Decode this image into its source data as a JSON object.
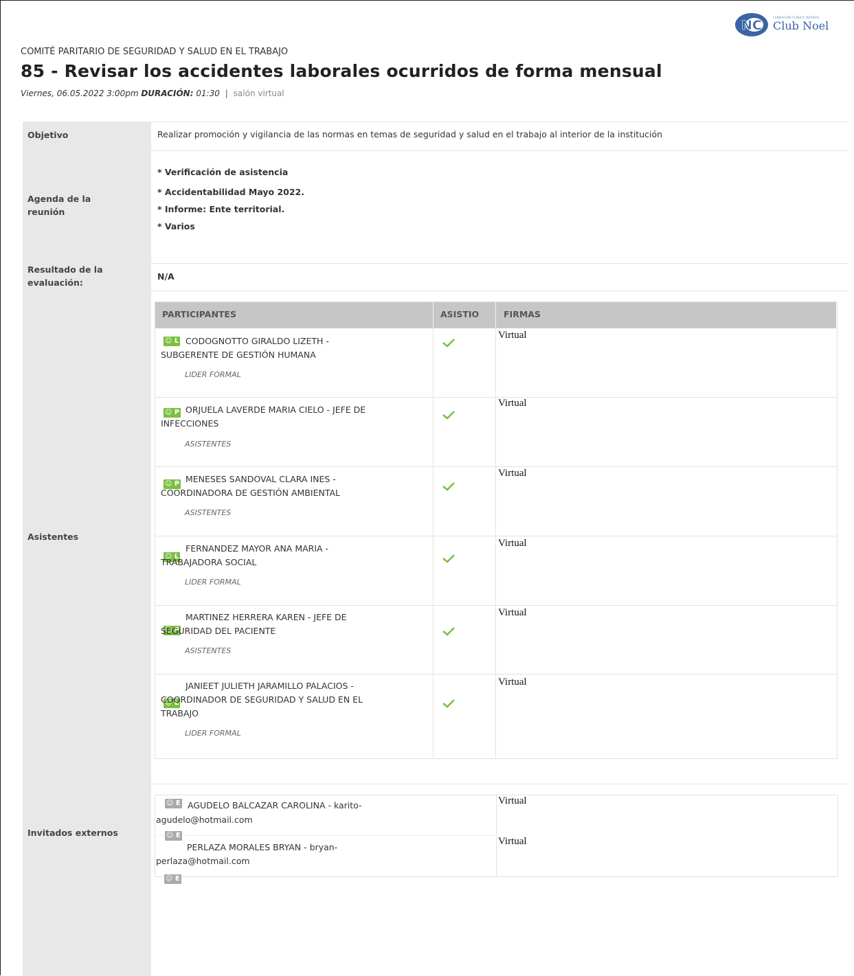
{
  "logo": {
    "initials": "NC",
    "tagline": "FUNDACIÓN CLÍNICA INFANTIL",
    "brand": "Club Noel"
  },
  "header": {
    "org": "COMITÉ PARITARIO DE SEGURIDAD Y SALUD EN EL TRABAJO",
    "title": "85 - Revisar los accidentes laborales ocurridos de forma mensual",
    "date": "Viernes, 06.05.2022 3:00pm",
    "duration_label": "DURACIÓN:",
    "duration": "01:30",
    "separator": "|",
    "room": "salón virtual"
  },
  "labels": {
    "objetivo": "Objetivo",
    "agenda_1": "Agenda de la",
    "agenda_2": "reunión",
    "resultado_1": "Resultado de la",
    "resultado_2": "evaluación:",
    "asistentes": "Asistentes",
    "invitados": "Invitados externos"
  },
  "objetivo": "Realizar promoción y vigilancia de las normas en temas de seguridad y salud en el trabajo al interior de la institución",
  "agenda": [
    "* Verificación de asistencia",
    "* Accidentabilidad Mayo 2022.",
    "* Informe: Ente territorial.",
    "* Varios"
  ],
  "resultado": "N/A",
  "table": {
    "col_participantes": "PARTICIPANTES",
    "col_asistio": "ASISTIO",
    "col_firmas": "FIRMAS",
    "rows": [
      {
        "badge": "☺ L",
        "name1": "CODOGNOTTO GIRALDO LIZETH -",
        "name2": "SUBGERENTE DE GESTIÓN HUMANA",
        "name3": "",
        "role": "LIDER FORMAL",
        "firma": "Virtual"
      },
      {
        "badge": "☺ P",
        "name1": "ORJUELA LAVERDE MARIA CIELO - JEFE DE",
        "name2": "INFECCIONES",
        "name3": "",
        "role": "ASISTENTES",
        "firma": "Virtual"
      },
      {
        "badge": "☺ P",
        "name1": "MENESES SANDOVAL CLARA INES -",
        "name2": "COORDINADORA DE GESTIÓN AMBIENTAL",
        "name3": "",
        "role": "ASISTENTES",
        "firma": "Virtual"
      },
      {
        "badge": "☺ L",
        "name1": "FERNANDEZ MAYOR ANA MARIA -",
        "name2": "TRABAJADORA SOCIAL",
        "name3": "",
        "role": "LIDER FORMAL",
        "firma": "Virtual"
      },
      {
        "badge": "☺ P",
        "name1": "MARTINEZ HERRERA KAREN - JEFE DE",
        "name2": "SEGURIDAD DEL PACIENTE",
        "name3": "",
        "role": "ASISTENTES",
        "firma": "Virtual"
      },
      {
        "badge": "☺ L",
        "name1": "JANIEET JULIETH JARAMILLO PALACIOS -",
        "name2": "COORDINADOR DE SEGURIDAD Y SALUD EN EL",
        "name3": "TRABAJO",
        "role": "LIDER FORMAL",
        "firma": "Virtual"
      }
    ]
  },
  "invitados": [
    {
      "badge": "☺ E",
      "name1": "AGUDELO BALCAZAR CAROLINA - karito-",
      "name2": "agudelo@hotmail.com",
      "firma": "Virtual"
    },
    {
      "badge": "☺ E",
      "name1": "PERLAZA MORALES BRYAN - bryan-",
      "name2": "perlaza@hotmail.com",
      "firma": "Virtual"
    }
  ],
  "extra_badge": "☺ E",
  "colors": {
    "badge_green": "#7bbf3f",
    "badge_gray": "#aaaaaa",
    "check_green": "#7bbf3f",
    "label_bg": "#e8e8e8",
    "header_bg": "#c6c6c6"
  },
  "icons": {
    "attended": "check-icon",
    "person_badge": "person-icon"
  }
}
